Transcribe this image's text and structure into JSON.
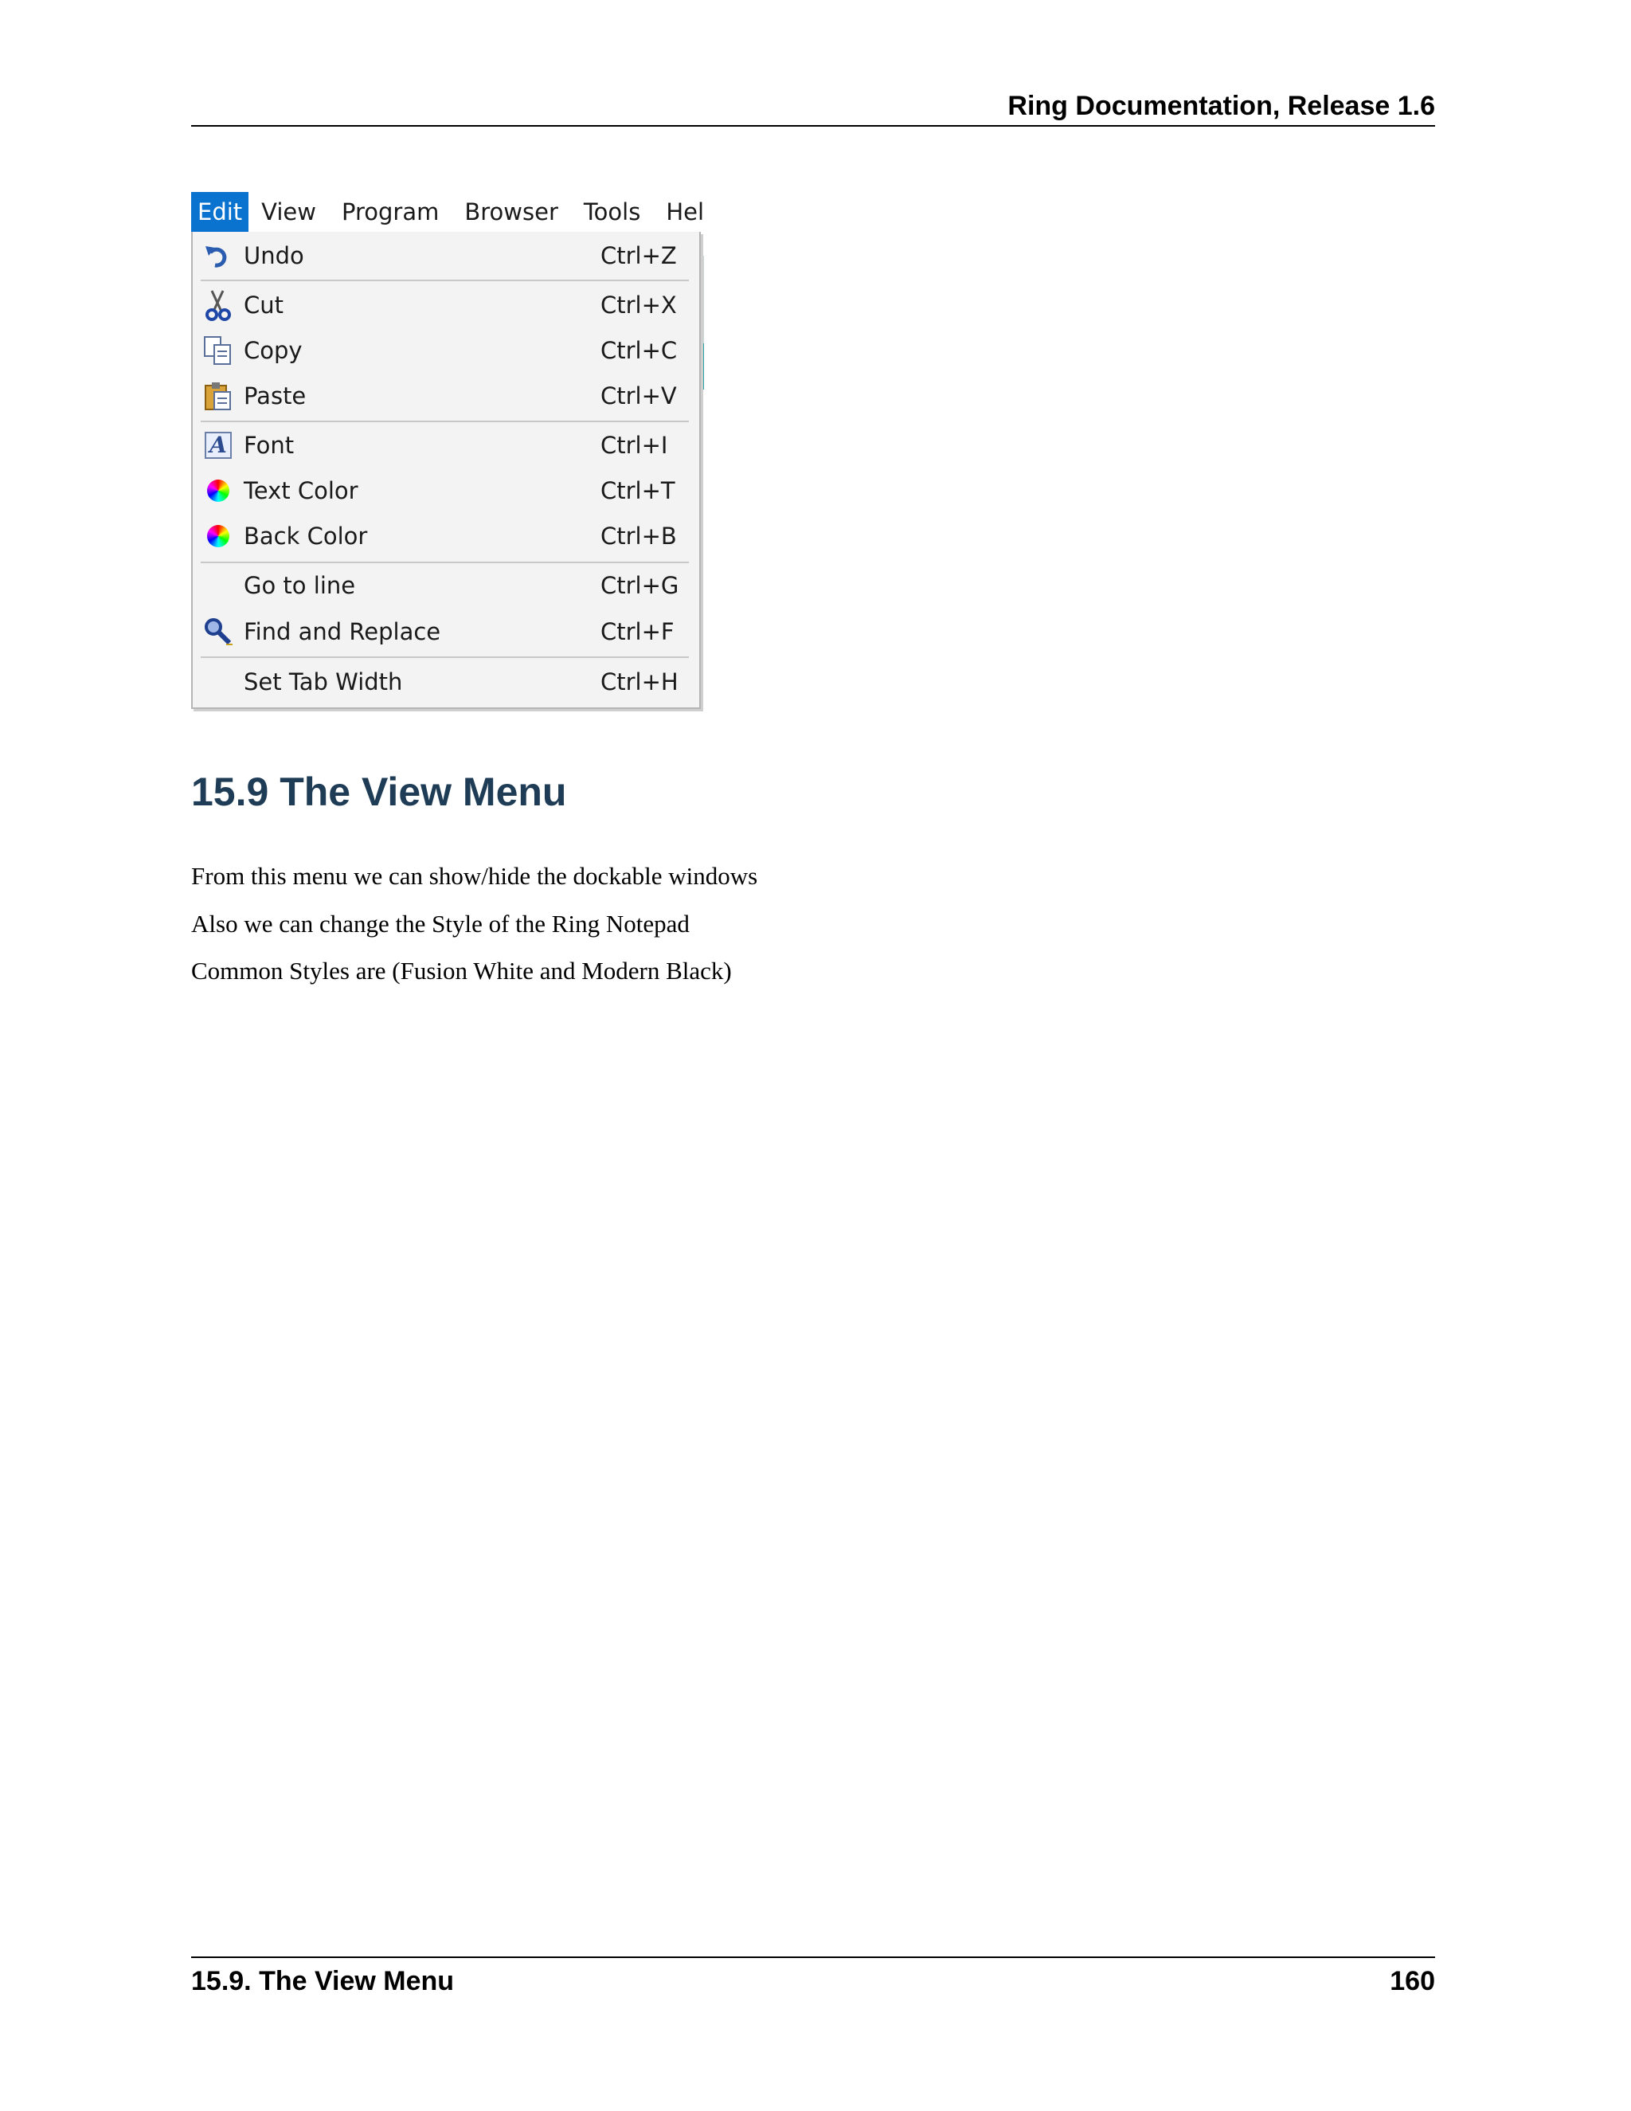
{
  "header": {
    "title": "Ring Documentation, Release 1.6"
  },
  "menubar": {
    "items": [
      "Edit",
      "View",
      "Program",
      "Browser",
      "Tools",
      "Help"
    ]
  },
  "edit_menu": {
    "items": [
      {
        "label": "Undo",
        "shortcut": "Ctrl+Z",
        "icon": "undo-icon"
      },
      {
        "label": "Cut",
        "shortcut": "Ctrl+X",
        "icon": "scissors-icon"
      },
      {
        "label": "Copy",
        "shortcut": "Ctrl+C",
        "icon": "copy-icon"
      },
      {
        "label": "Paste",
        "shortcut": "Ctrl+V",
        "icon": "clipboard-icon"
      },
      {
        "label": "Font",
        "shortcut": "Ctrl+I",
        "icon": "font-icon"
      },
      {
        "label": "Text Color",
        "shortcut": "Ctrl+T",
        "icon": "color-wheel-icon"
      },
      {
        "label": "Back Color",
        "shortcut": "Ctrl+B",
        "icon": "color-wheel-icon"
      },
      {
        "label": "Go to line",
        "shortcut": "Ctrl+G",
        "icon": ""
      },
      {
        "label": "Find and Replace",
        "shortcut": "Ctrl+F",
        "icon": "find-icon"
      },
      {
        "label": "Set Tab Width",
        "shortcut": "Ctrl+H",
        "icon": ""
      }
    ]
  },
  "section": {
    "title": "15.9  The View Menu",
    "paragraphs": [
      "From this menu we can show/hide the dockable windows",
      "Also we can change the Style of the Ring Notepad",
      "Common Styles are (Fusion White and Modern Black)"
    ]
  },
  "footer": {
    "section": "15.9.  The View Menu",
    "page": "160"
  }
}
